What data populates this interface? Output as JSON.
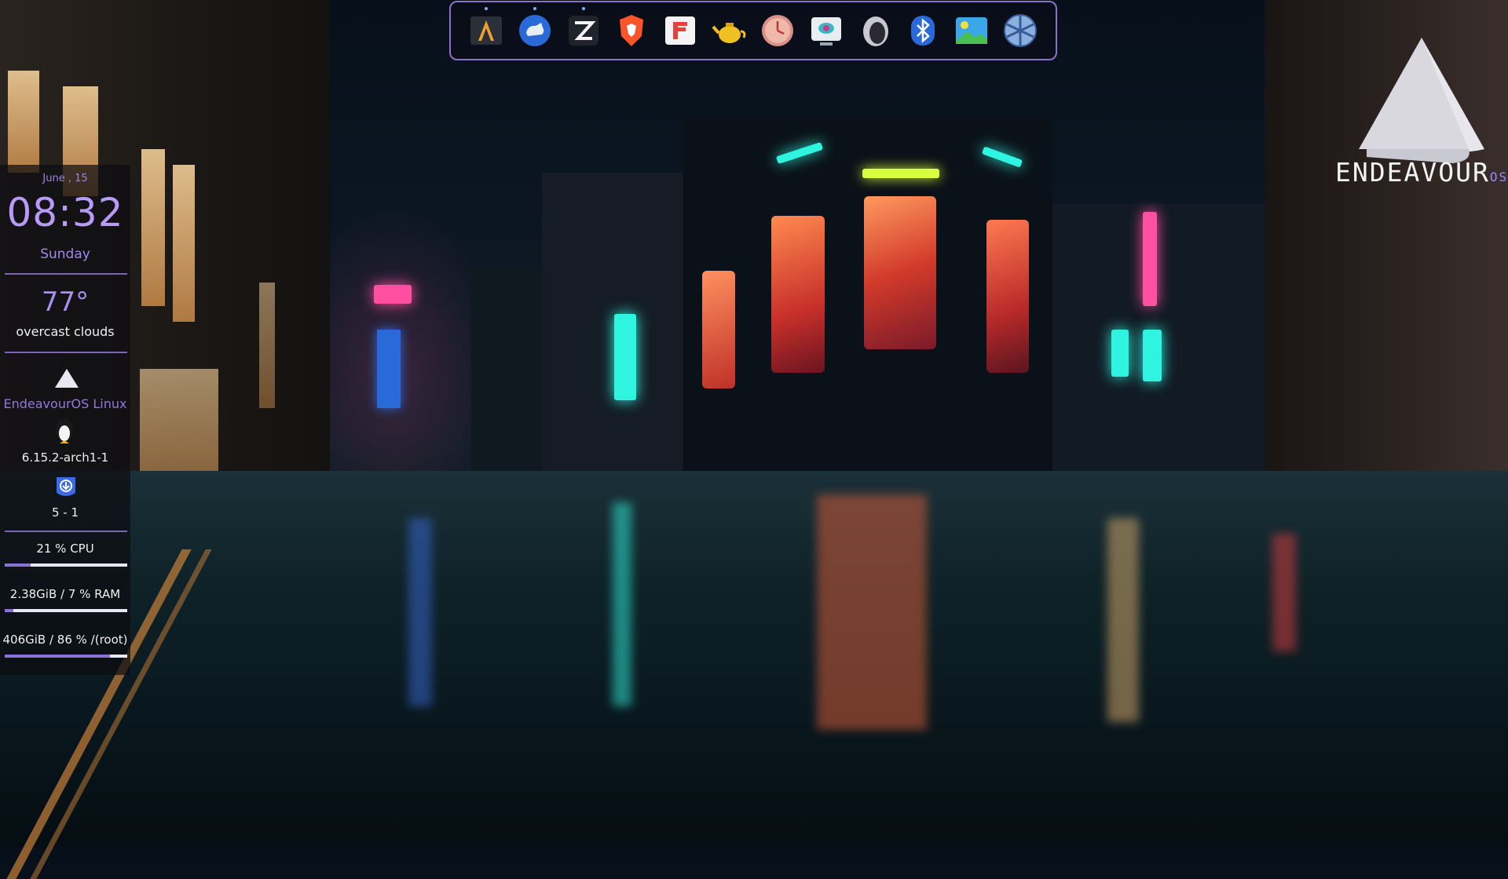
{
  "dock": {
    "items": [
      {
        "name": "alacritty",
        "icon": "alacritty-icon"
      },
      {
        "name": "finder-files",
        "icon": "file-manager-icon"
      },
      {
        "name": "zed",
        "icon": "zed-editor-icon"
      },
      {
        "name": "brave",
        "icon": "brave-browser-icon"
      },
      {
        "name": "flatpak",
        "icon": "flatpak-store-icon"
      },
      {
        "name": "teapot",
        "icon": "teapot-icon"
      },
      {
        "name": "clock",
        "icon": "clock-icon"
      },
      {
        "name": "system-monitor",
        "icon": "monitor-icon"
      },
      {
        "name": "audio",
        "icon": "speaker-icon"
      },
      {
        "name": "bluetooth",
        "icon": "bluetooth-icon"
      },
      {
        "name": "image-viewer",
        "icon": "image-viewer-icon"
      },
      {
        "name": "network",
        "icon": "network-globe-icon"
      }
    ]
  },
  "widget": {
    "date": "June , 15",
    "time": "08:32",
    "day": "Sunday",
    "temperature": "77°",
    "weather": "overcast clouds",
    "os_name": "EndeavourOS Linux",
    "kernel": "6.15.2-arch1-1",
    "updates": "5 - 1",
    "cpu_label": "21 % CPU",
    "cpu_percent": 21,
    "ram_label": "2.38GiB / 7 % RAM",
    "ram_percent": 7,
    "disk_label": "406GiB / 86 % /(root)",
    "disk_percent": 86
  },
  "logo": {
    "text_main": "ENDEAVOUR",
    "text_accent": "OS"
  },
  "colors": {
    "accent": "#8a72d8",
    "dock_border": "#8a72c8",
    "logo_accent": "#9f86ff"
  }
}
